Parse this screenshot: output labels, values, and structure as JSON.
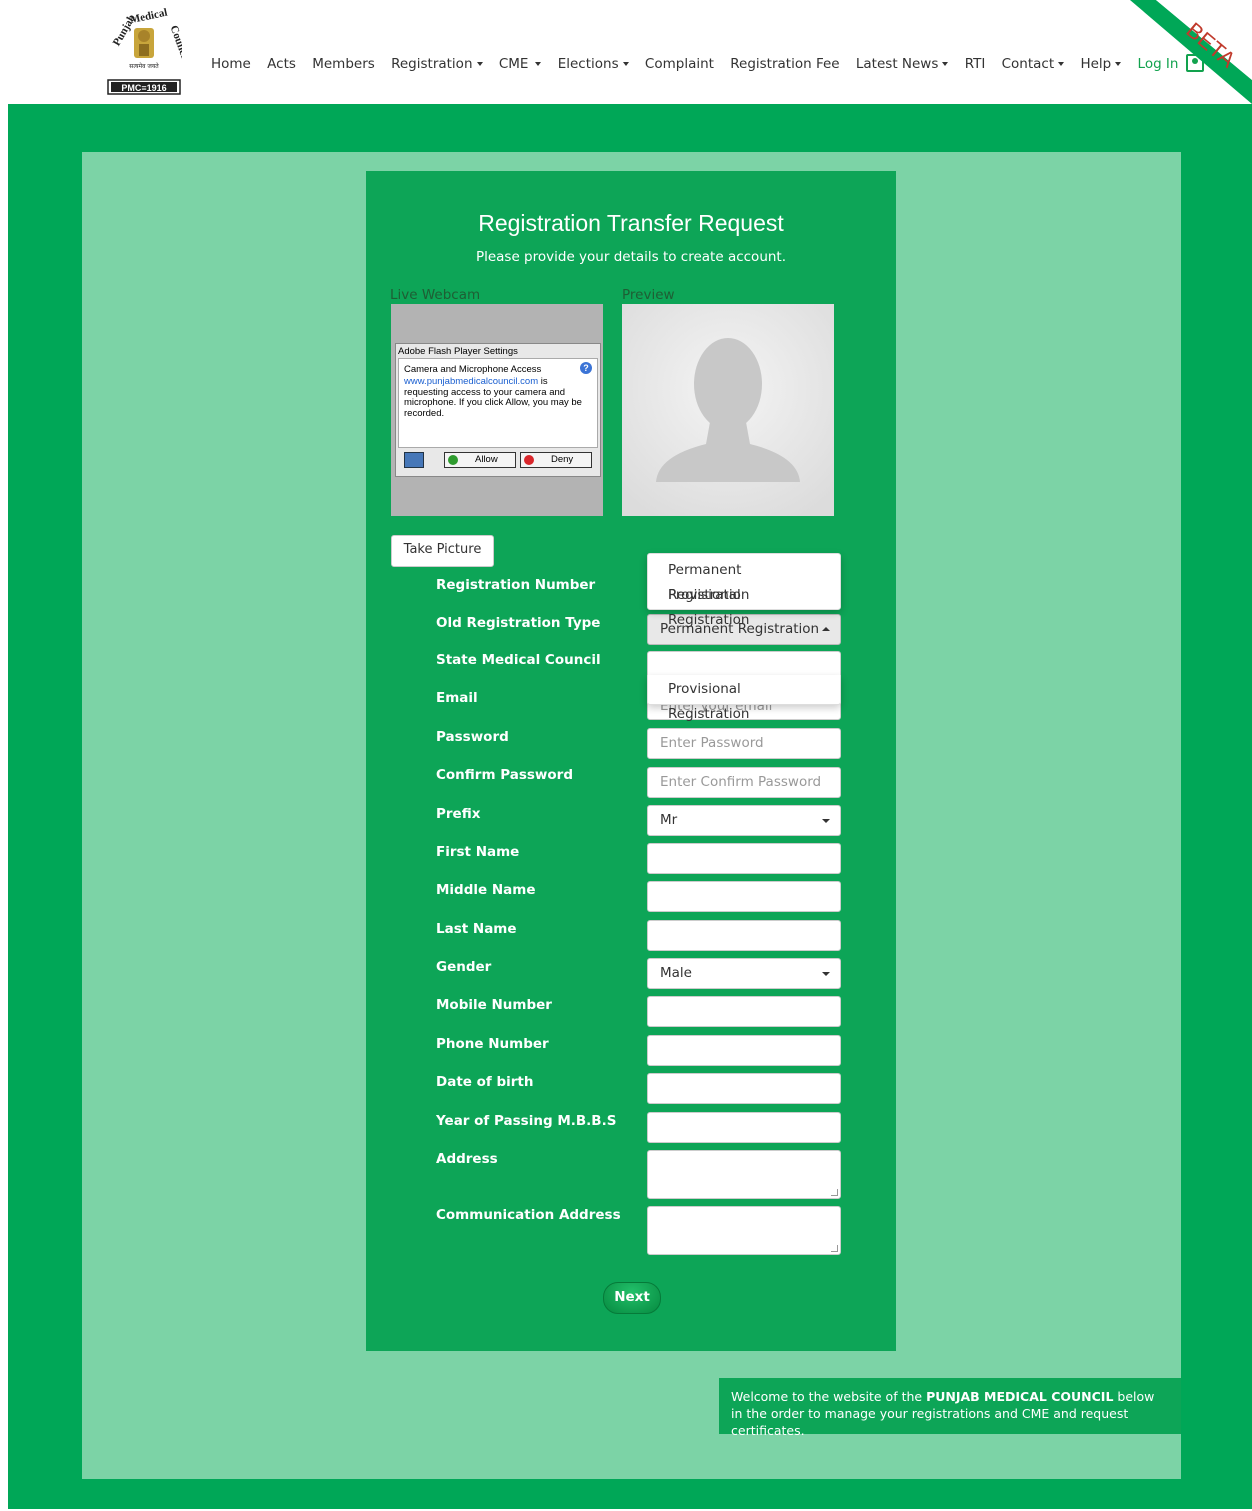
{
  "header": {
    "logo_text": "PMC≡1916",
    "nav": [
      {
        "label": "Home",
        "dropdown": false
      },
      {
        "label": "Acts",
        "dropdown": false
      },
      {
        "label": "Members",
        "dropdown": false
      },
      {
        "label": "Registration",
        "dropdown": true
      },
      {
        "label": "CME",
        "dropdown": true
      },
      {
        "label": "Elections",
        "dropdown": true
      },
      {
        "label": "Complaint",
        "dropdown": false
      },
      {
        "label": "Registration Fee",
        "dropdown": false
      },
      {
        "label": "Latest News",
        "dropdown": true
      },
      {
        "label": "RTI",
        "dropdown": false
      },
      {
        "label": "Contact",
        "dropdown": true
      },
      {
        "label": "Help",
        "dropdown": true
      }
    ],
    "login": "Log In",
    "beta": "BETA"
  },
  "form": {
    "title": "Registration Transfer Request",
    "subtitle": "Please provide your details to create account.",
    "webcam_label": "Live Webcam",
    "preview_label": "Preview",
    "flash": {
      "title": "Adobe Flash Player Settings",
      "heading": "Camera and Microphone Access",
      "link": "www.punjabmedicalcouncil.com",
      "body": "is requesting access to your camera and microphone. If you click Allow, you may be recorded.",
      "allow": "Allow",
      "deny": "Deny"
    },
    "take_picture": "Take Picture",
    "labels": {
      "registration_number": "Registration Number",
      "old_registration_type": "Old Registration Type",
      "state_medical_council": "State Medical Council",
      "email": "Email",
      "password": "Password",
      "confirm_password": "Confirm Password",
      "prefix": "Prefix",
      "first_name": "First Name",
      "middle_name": "Middle Name",
      "last_name": "Last Name",
      "gender": "Gender",
      "mobile_number": "Mobile Number",
      "phone_number": "Phone Number",
      "dob": "Date of birth",
      "year_passing": "Year of Passing M.B.B.S",
      "address": "Address",
      "communication_address": "Communication Address"
    },
    "values": {
      "old_registration_type": "Permanent Registration",
      "prefix": "Mr",
      "gender": "Male"
    },
    "placeholders": {
      "email": "Enter your email",
      "password": "Enter Password",
      "confirm_password": "Enter Confirm Password"
    },
    "dropdown_options": [
      "Permanent Registration",
      "Provisional Registration"
    ],
    "dropdown2_option": "Provisional Registration",
    "next": "Next"
  },
  "welcome": {
    "text_before": "Welcome to the website of the ",
    "bold": "PUNJAB MEDICAL COUNCIL",
    "text_after": " below in the order to manage your registrations and CME and request certificates."
  },
  "colors": {
    "brand_green": "#00a757",
    "light_green": "#7cd3a6",
    "beta_red": "#c0392b"
  }
}
